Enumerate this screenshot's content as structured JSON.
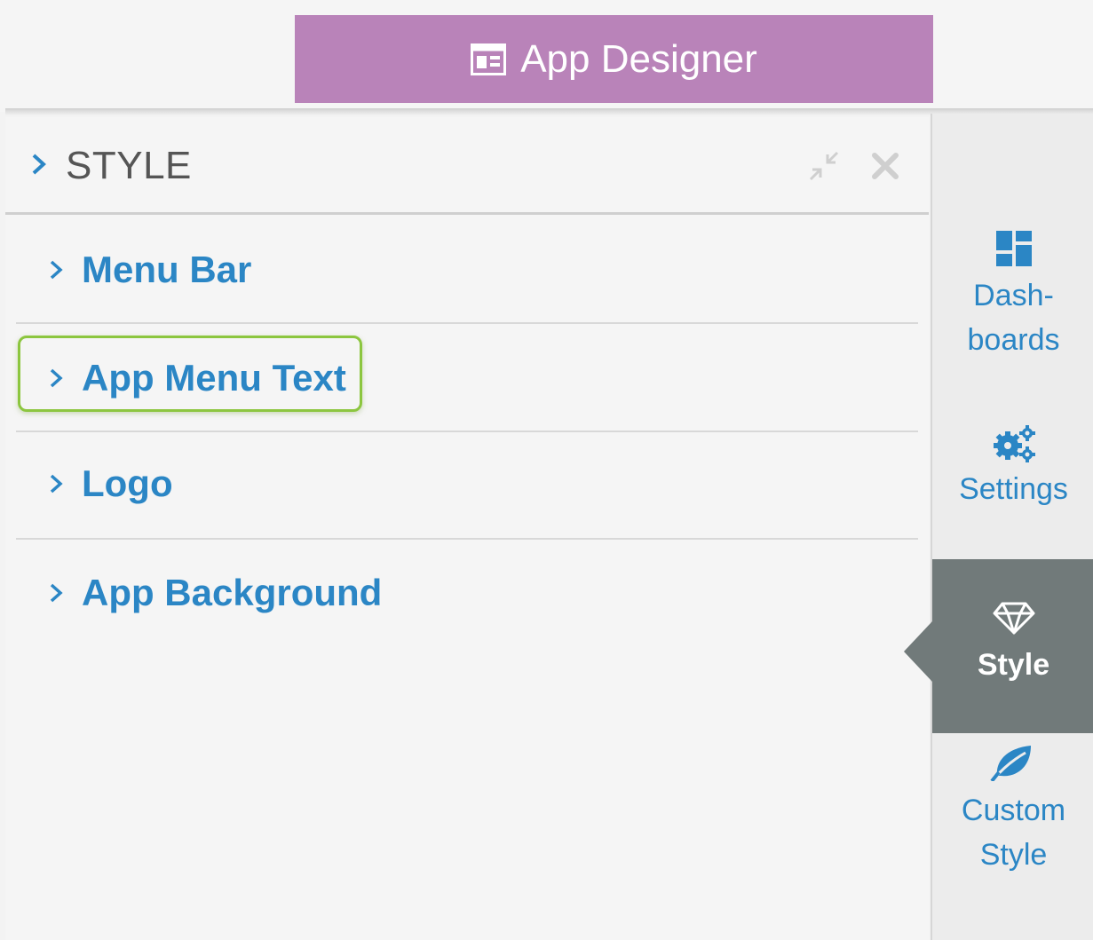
{
  "header": {
    "title": "App Designer"
  },
  "panel": {
    "title": "STYLE",
    "items": [
      {
        "label": "Menu Bar"
      },
      {
        "label": "App Menu Text"
      },
      {
        "label": "Logo"
      },
      {
        "label": "App Background"
      }
    ]
  },
  "rail": {
    "dashboards": {
      "line1": "Dash-",
      "line2": "boards"
    },
    "settings": {
      "label": "Settings"
    },
    "style": {
      "label": "Style"
    },
    "custom_style": {
      "line1": "Custom",
      "line2": "Style"
    }
  },
  "colors": {
    "header_bg": "#b983b9",
    "link": "#2b86c5",
    "active_tab": "#717a7a",
    "highlight": "#8cc63f"
  },
  "icons": {
    "header": "layout-icon",
    "dashboards": "dashboard-grid-icon",
    "settings": "gears-icon",
    "style": "diamond-icon",
    "custom_style": "leaf-icon"
  }
}
